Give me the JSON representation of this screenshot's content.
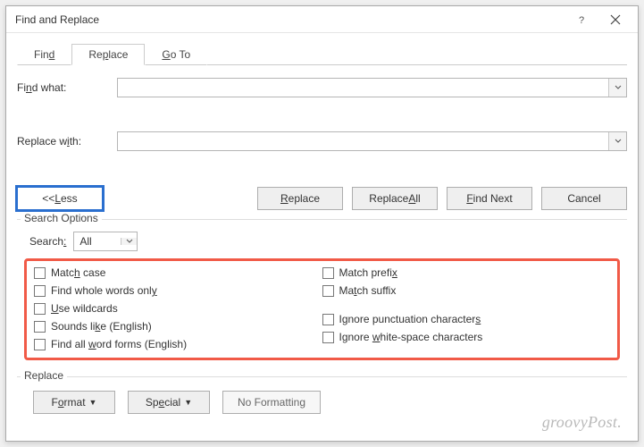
{
  "window": {
    "title": "Find and Replace",
    "help_icon": "help-icon",
    "close_icon": "close-icon"
  },
  "tabs": {
    "find": "Find",
    "replace": "Replace",
    "goto": "Go To"
  },
  "fields": {
    "find_label": "Find what:",
    "find_value": "",
    "replace_label": "Replace with:",
    "replace_value": ""
  },
  "buttons": {
    "less": "<< Less",
    "replace": "Replace",
    "replace_all": "Replace All",
    "find_next": "Find Next",
    "cancel": "Cancel",
    "format": "Format",
    "special": "Special",
    "no_formatting": "No Formatting"
  },
  "search_options": {
    "legend": "Search Options",
    "search_label": "Search:",
    "search_value": "All",
    "left": [
      "Match case",
      "Find whole words only",
      "Use wildcards",
      "Sounds like (English)",
      "Find all word forms (English)"
    ],
    "right": [
      "Match prefix",
      "Match suffix",
      "Ignore punctuation characters",
      "Ignore white-space characters"
    ]
  },
  "replace_group": {
    "legend": "Replace"
  },
  "watermark": "groovyPost."
}
